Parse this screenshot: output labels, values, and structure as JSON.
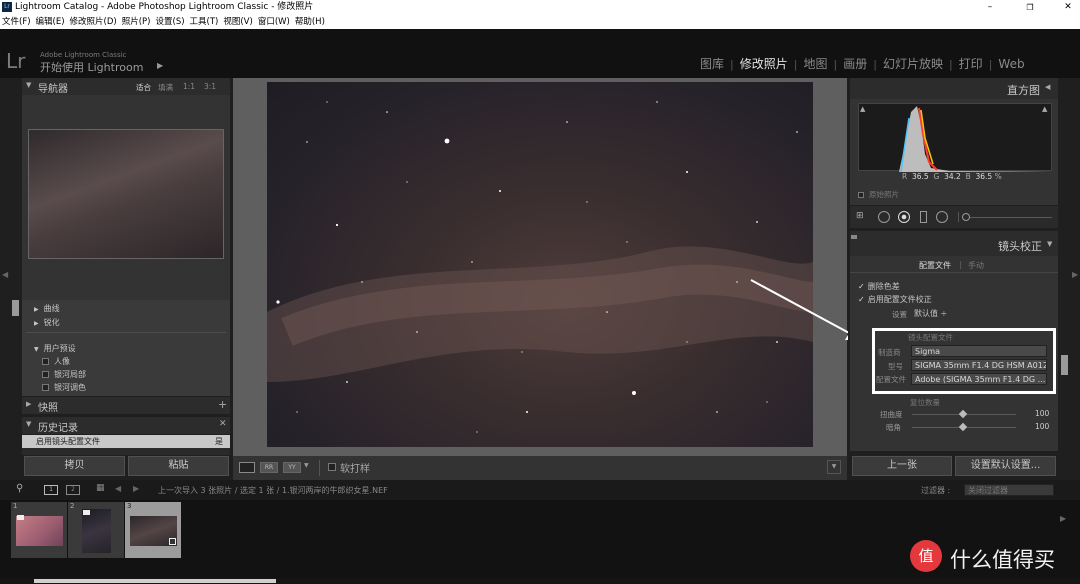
{
  "window": {
    "title": "Lightroom Catalog - Adobe Photoshop Lightroom Classic - 修改照片"
  },
  "menu": [
    "文件(F)",
    "编辑(E)",
    "修改照片(D)",
    "照片(P)",
    "设置(S)",
    "工具(T)",
    "视图(V)",
    "窗口(W)",
    "帮助(H)"
  ],
  "identity": {
    "logo": "Lr",
    "product": "Adobe Lightroom Classic",
    "tagline": "开始使用 Lightroom"
  },
  "modules": [
    "图库",
    "修改照片",
    "地图",
    "画册",
    "幻灯片放映",
    "打印",
    "Web"
  ],
  "left": {
    "navigator": {
      "title": "导航器",
      "zoom": [
        "适合",
        "填满",
        "1:1",
        "3:1"
      ]
    },
    "presets": [
      {
        "label": "曲线",
        "type": "folder"
      },
      {
        "label": "锐化",
        "type": "folder"
      },
      {
        "label": "用户预设",
        "type": "open-folder"
      },
      {
        "label": "人像",
        "type": "preset"
      },
      {
        "label": "银河局部",
        "type": "preset"
      },
      {
        "label": "银河调色",
        "type": "preset"
      }
    ],
    "snapshots": {
      "title": "快照"
    },
    "history": {
      "title": "历史记录",
      "entry": "启用镜头配置文件",
      "entry_value": "是"
    },
    "buttons": {
      "copy": "拷贝",
      "paste": "粘贴"
    }
  },
  "toolbar": {
    "softproof": "软打样"
  },
  "right": {
    "histogram": {
      "title": "直方图",
      "r_label": "R",
      "r": "36.5",
      "g_label": "G",
      "g": "34.2",
      "b_label": "B",
      "b": "36.5",
      "unit": "%",
      "original": "原始照片"
    },
    "lens": {
      "title": "镜头校正",
      "tabs": [
        "配置文件",
        "手动"
      ],
      "remove_ca": "删除色差",
      "enable_profile": "启用配置文件校正",
      "setup_label": "设置",
      "setup_value": "默认值 ÷",
      "profile_header": "镜头配置文件",
      "make_label": "制造商",
      "make": "Sigma",
      "model_label": "型号",
      "model": "SIGMA 35mm F1.4 DG HSM A012",
      "profile_label": "配置文件",
      "profile": "Adobe (SIGMA 35mm F1.4 DG ...",
      "amount_header": "复位数量",
      "distortion_label": "扭曲度",
      "distortion": "100",
      "vignetting_label": "暗角",
      "vignetting": "100"
    },
    "buttons": {
      "previous": "上一张",
      "reset": "设置默认设置..."
    }
  },
  "filmstrip": {
    "pages": [
      "1",
      "2"
    ],
    "path": "上一次导入  3 张照片 / 选定 1 张 / 1.银河两岸的牛郎织女星.NEF",
    "filter_label": "过滤器 :",
    "filter_value": "关闭过滤器",
    "thumbs": [
      {
        "num": "1"
      },
      {
        "num": "2"
      },
      {
        "num": "3"
      }
    ]
  },
  "watermark": {
    "symbol": "值",
    "text": "什么值得买"
  }
}
